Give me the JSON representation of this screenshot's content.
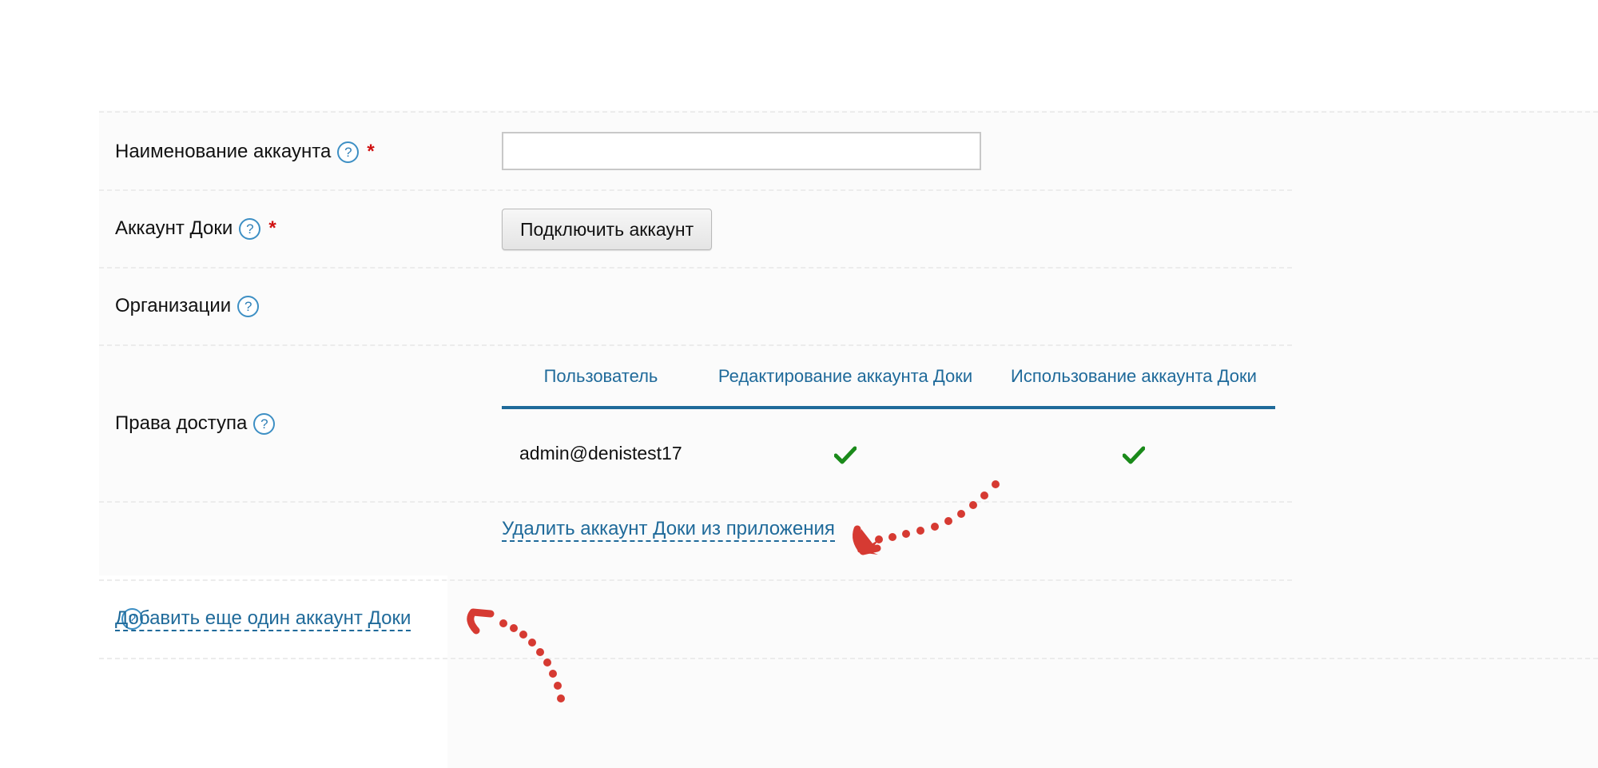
{
  "form": {
    "account_name": {
      "label": "Наименование аккаунта",
      "help": "?",
      "required_mark": "*",
      "value": ""
    },
    "docs_account": {
      "label": "Аккаунт Доки",
      "help": "?",
      "required_mark": "*",
      "button_label": "Подключить аккаунт"
    },
    "organizations": {
      "label": "Организации",
      "help": "?"
    },
    "access_rights": {
      "label": "Права доступа",
      "help": "?",
      "table": {
        "headers": [
          "Пользователь",
          "Редактирование аккаунта Доки",
          "Использование аккаунта Доки"
        ],
        "rows": [
          {
            "user": "admin@denistest17",
            "edit": true,
            "use": true
          }
        ]
      }
    },
    "remove_link": "Удалить аккаунт Доки из приложения",
    "add_link": {
      "label": "Добавить еще один аккаунт Доки",
      "help": "?"
    }
  },
  "colors": {
    "accent": "#1f6a9a",
    "required": "#d01010",
    "check": "#1a8a1a",
    "annotation_arrow": "#d63a32"
  },
  "icons": {
    "help": "question-circle-icon",
    "check": "checkmark-icon",
    "annotation": "dotted-arrow-icon"
  }
}
